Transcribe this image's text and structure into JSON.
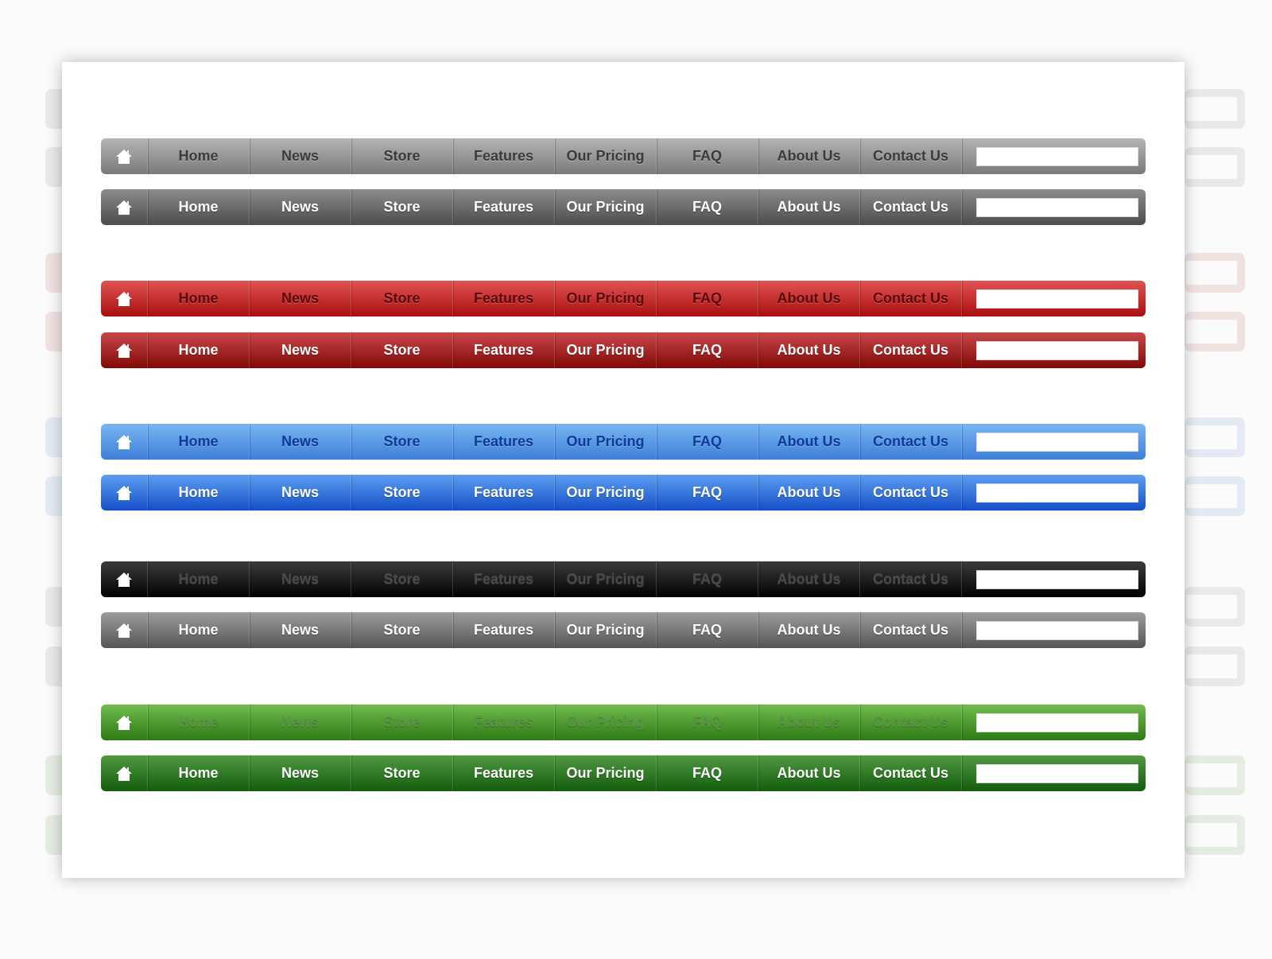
{
  "nav_items": [
    "Home",
    "News",
    "Store",
    "Features",
    "Our Pricing",
    "FAQ",
    "About Us",
    "Contact Us"
  ],
  "home_icon": "house-icon",
  "search": {
    "value": "",
    "placeholder": ""
  },
  "bars": [
    {
      "theme": "gray-light",
      "accent": "#9a9a9a",
      "text_color": "#3a3a3a"
    },
    {
      "theme": "gray-dark",
      "accent": "#6a6a6a",
      "text_color": "#ffffff"
    },
    {
      "theme": "red-light",
      "accent": "#c82a2a",
      "text_color": "#5a0606"
    },
    {
      "theme": "red-dark",
      "accent": "#a52020",
      "text_color": "#ffffff"
    },
    {
      "theme": "blue-light",
      "accent": "#5a9ae6",
      "text_color": "#0c3a94"
    },
    {
      "theme": "blue-dark",
      "accent": "#3578dc",
      "text_color": "#ffffff"
    },
    {
      "theme": "black",
      "accent": "#1a1a1a",
      "text_color": "#4a4a4a"
    },
    {
      "theme": "gray-medium",
      "accent": "#7a7a7a",
      "text_color": "#ffffff"
    },
    {
      "theme": "green-light",
      "accent": "#4f9a30",
      "text_color": "#5a9448"
    },
    {
      "theme": "green-dark",
      "accent": "#307a26",
      "text_color": "#ffffff"
    }
  ]
}
